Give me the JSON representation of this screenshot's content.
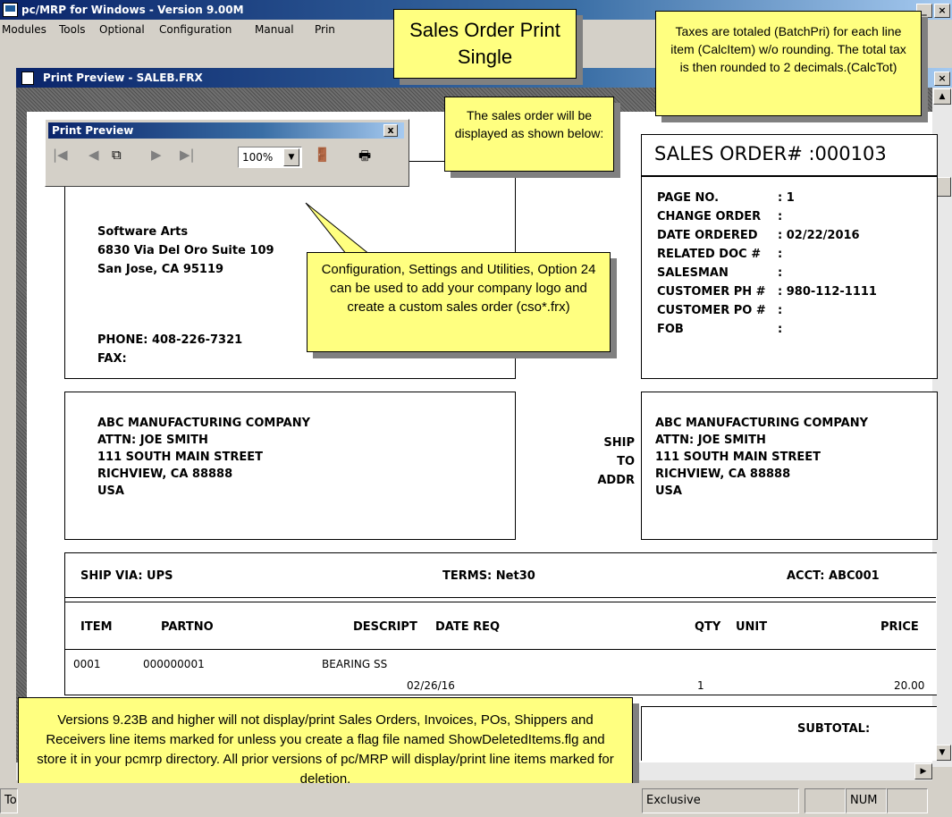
{
  "app": {
    "title": "pc/MRP for Windows - Version 9.00M",
    "menu": [
      "Modules",
      "Tools",
      "Optional",
      "Configuration",
      "Manual",
      "Prin"
    ]
  },
  "preview_window": {
    "title": "Print Preview - SALEB.FRX"
  },
  "toolbar": {
    "title": "Print Preview",
    "zoom": "100%",
    "close_label": "x"
  },
  "callouts": {
    "main_title": "Sales Order Print Single",
    "tax_note": "Taxes are totaled (BatchPri) for each line item (CalcItem) w/o rounding.  The total tax is then rounded to 2 decimals.(CalcTot)",
    "display_note": "The sales order will be displayed as shown below:",
    "config_note": "Configuration, Settings and Utilities, Option 24 can be used to add your company logo and create a custom sales order (cso*.frx)",
    "version_note": "Versions 9.23B and higher will not display/print Sales Orders, Invoices, POs, Shippers and Receivers line items marked for unless you create a flag file named ShowDeletedItems.flg and store it in your pcmrp directory.  All prior versions of pc/MRP will display/print line items marked for deletion."
  },
  "document": {
    "company": {
      "name": "Software Arts",
      "address1": "6830 Via Del Oro Suite 109",
      "address2": "San Jose, CA 95119",
      "phone": "PHONE: 408-226-7321",
      "fax": "FAX:"
    },
    "order_number": "SALES ORDER# :000103",
    "header_fields": [
      {
        "label": "PAGE NO.",
        "value": ": 1"
      },
      {
        "label": "CHANGE ORDER",
        "value": ":"
      },
      {
        "label": "DATE ORDERED",
        "value": ": 02/22/2016"
      },
      {
        "label": "RELATED DOC #",
        "value": ":"
      },
      {
        "label": "SALESMAN",
        "value": ":"
      },
      {
        "label": "CUSTOMER PH #",
        "value": ": 980-112-1111"
      },
      {
        "label": "CUSTOMER PO #",
        "value": ":"
      },
      {
        "label": "FOB",
        "value": ":"
      }
    ],
    "bill_to": [
      "ABC MANUFACTURING COMPANY",
      "ATTN: JOE SMITH",
      "111 SOUTH MAIN STREET",
      "RICHVIEW, CA 88888",
      "USA"
    ],
    "ship_to_label": [
      "SHIP",
      "TO",
      "ADDR"
    ],
    "ship_to": [
      "ABC MANUFACTURING COMPANY",
      "ATTN: JOE SMITH",
      "111 SOUTH MAIN STREET",
      "RICHVIEW, CA 88888",
      "USA"
    ],
    "ship_via": "SHIP VIA: UPS",
    "terms": "TERMS: Net30",
    "acct": "ACCT: ABC001",
    "columns": [
      "ITEM",
      "PARTNO",
      "DESCRIPT",
      "DATE REQ",
      "QTY",
      "UNIT",
      "PRICE"
    ],
    "line": {
      "item": "0001",
      "partno": "000000001",
      "descript": "BEARING SS",
      "date_req": "02/26/16",
      "qty": "1",
      "price": "20.00"
    },
    "subtotal_label": "SUBTOTAL:"
  },
  "statusbar": {
    "left": "To",
    "mode": "Exclusive",
    "num": "NUM"
  }
}
